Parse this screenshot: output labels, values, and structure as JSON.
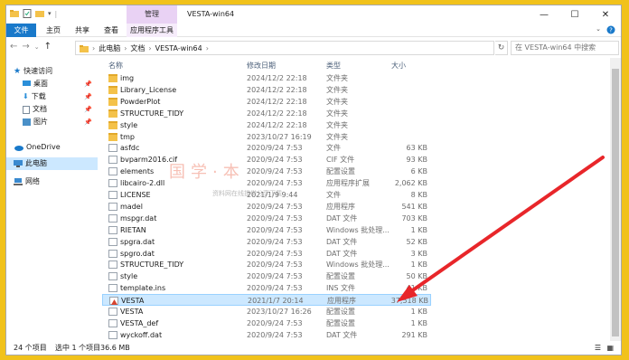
{
  "window": {
    "title": "VESTA-win64",
    "context_tab_group": "管理",
    "controls": {
      "minimize": "—",
      "maximize": "☐",
      "close": "✕"
    }
  },
  "ribbon": {
    "tabs": [
      "文件",
      "主页",
      "共享",
      "查看"
    ],
    "context_tab": "应用程序工具"
  },
  "address": {
    "path": [
      "此电脑",
      "文档",
      "VESTA-win64"
    ],
    "search_placeholder": "在 VESTA-win64 中搜索"
  },
  "sidebar": {
    "items": [
      {
        "label": "快速访问",
        "icon": "star-icon"
      },
      {
        "label": "桌面",
        "icon": "desktop-icon",
        "pinned": true
      },
      {
        "label": "下载",
        "icon": "download-icon",
        "pinned": true
      },
      {
        "label": "文档",
        "icon": "document-icon",
        "pinned": true
      },
      {
        "label": "图片",
        "icon": "picture-icon",
        "pinned": true
      },
      {
        "label": "OneDrive",
        "icon": "cloud-icon"
      },
      {
        "label": "此电脑",
        "icon": "computer-icon",
        "selected": true
      },
      {
        "label": "网络",
        "icon": "network-icon"
      }
    ]
  },
  "columns": {
    "name": "名称",
    "date": "修改日期",
    "type": "类型",
    "size": "大小"
  },
  "files": [
    {
      "name": "img",
      "date": "2024/12/2 22:18",
      "type": "文件夹",
      "size": "",
      "icon": "folder"
    },
    {
      "name": "Library_License",
      "date": "2024/12/2 22:18",
      "type": "文件夹",
      "size": "",
      "icon": "folder"
    },
    {
      "name": "PowderPlot",
      "date": "2024/12/2 22:18",
      "type": "文件夹",
      "size": "",
      "icon": "folder"
    },
    {
      "name": "STRUCTURE_TIDY",
      "date": "2024/12/2 22:18",
      "type": "文件夹",
      "size": "",
      "icon": "folder"
    },
    {
      "name": "style",
      "date": "2024/12/2 22:18",
      "type": "文件夹",
      "size": "",
      "icon": "folder"
    },
    {
      "name": "tmp",
      "date": "2023/10/27 16:19",
      "type": "文件夹",
      "size": "",
      "icon": "folder"
    },
    {
      "name": "asfdc",
      "date": "2020/9/24 7:53",
      "type": "文件",
      "size": "63 KB",
      "icon": "doc"
    },
    {
      "name": "bvparm2016.cif",
      "date": "2020/9/24 7:53",
      "type": "CIF 文件",
      "size": "93 KB",
      "icon": "doc"
    },
    {
      "name": "elements",
      "date": "2020/9/24 7:53",
      "type": "配置设置",
      "size": "6 KB",
      "icon": "doc"
    },
    {
      "name": "libcairo-2.dll",
      "date": "2020/9/24 7:53",
      "type": "应用程序扩展",
      "size": "2,062 KB",
      "icon": "doc"
    },
    {
      "name": "LICENSE",
      "date": "2021/1/9 9:44",
      "type": "文件",
      "size": "8 KB",
      "icon": "doc"
    },
    {
      "name": "madel",
      "date": "2020/9/24 7:53",
      "type": "应用程序",
      "size": "541 KB",
      "icon": "exe"
    },
    {
      "name": "mspgr.dat",
      "date": "2020/9/24 7:53",
      "type": "DAT 文件",
      "size": "703 KB",
      "icon": "doc"
    },
    {
      "name": "RIETAN",
      "date": "2020/9/24 7:53",
      "type": "Windows 批处理...",
      "size": "1 KB",
      "icon": "exe"
    },
    {
      "name": "spgra.dat",
      "date": "2020/9/24 7:53",
      "type": "DAT 文件",
      "size": "52 KB",
      "icon": "doc"
    },
    {
      "name": "spgro.dat",
      "date": "2020/9/24 7:53",
      "type": "DAT 文件",
      "size": "3 KB",
      "icon": "doc"
    },
    {
      "name": "STRUCTURE_TIDY",
      "date": "2020/9/24 7:53",
      "type": "Windows 批处理...",
      "size": "1 KB",
      "icon": "exe"
    },
    {
      "name": "style",
      "date": "2020/9/24 7:53",
      "type": "配置设置",
      "size": "50 KB",
      "icon": "doc"
    },
    {
      "name": "template.ins",
      "date": "2020/9/24 7:53",
      "type": "INS 文件",
      "size": "41 KB",
      "icon": "doc"
    },
    {
      "name": "VESTA",
      "date": "2021/1/7 20:14",
      "type": "应用程序",
      "size": "37,518 KB",
      "icon": "vesta",
      "selected": true
    },
    {
      "name": "VESTA",
      "date": "2023/10/27 16:26",
      "type": "配置设置",
      "size": "1 KB",
      "icon": "doc"
    },
    {
      "name": "VESTA_def",
      "date": "2020/9/24 7:53",
      "type": "配置设置",
      "size": "1 KB",
      "icon": "doc"
    },
    {
      "name": "wyckoff.dat",
      "date": "2020/9/24 7:53",
      "type": "DAT 文件",
      "size": "291 KB",
      "icon": "doc"
    }
  ],
  "status": {
    "count": "24 个项目",
    "selected": "选中 1 个项目",
    "size": "36.6 MB"
  },
  "watermark": {
    "main": "国学·本",
    "sub": "资料网在线提供分享下载"
  },
  "colors": {
    "accent": "#1979ca",
    "selection": "#cce8ff",
    "arrow": "#e8262a",
    "frame": "#f1c21b"
  }
}
